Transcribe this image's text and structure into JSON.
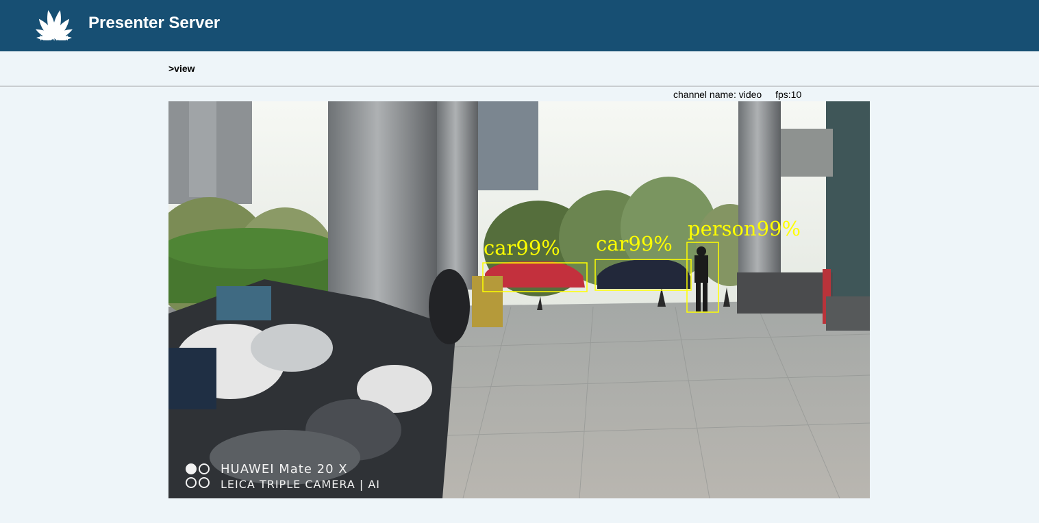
{
  "header": {
    "brand": "HUAWEI",
    "title": "Presenter Server",
    "background": "#174f73"
  },
  "breadcrumb": ">view",
  "channel": {
    "name_label": "channel name: video",
    "fps_label": "fps:10"
  },
  "detections": [
    {
      "label": "car99%",
      "class": "car",
      "confidence": "99%"
    },
    {
      "label": "car99%",
      "class": "car",
      "confidence": "99%"
    },
    {
      "label": "person99%",
      "class": "person",
      "confidence": "99%"
    }
  ],
  "video_watermark": {
    "line1": "HUAWEI Mate 20 X",
    "line2": "LEICA TRIPLE CAMERA | AI"
  },
  "colors": {
    "page_background": "#eef5f9",
    "detection": "#ffff00"
  }
}
